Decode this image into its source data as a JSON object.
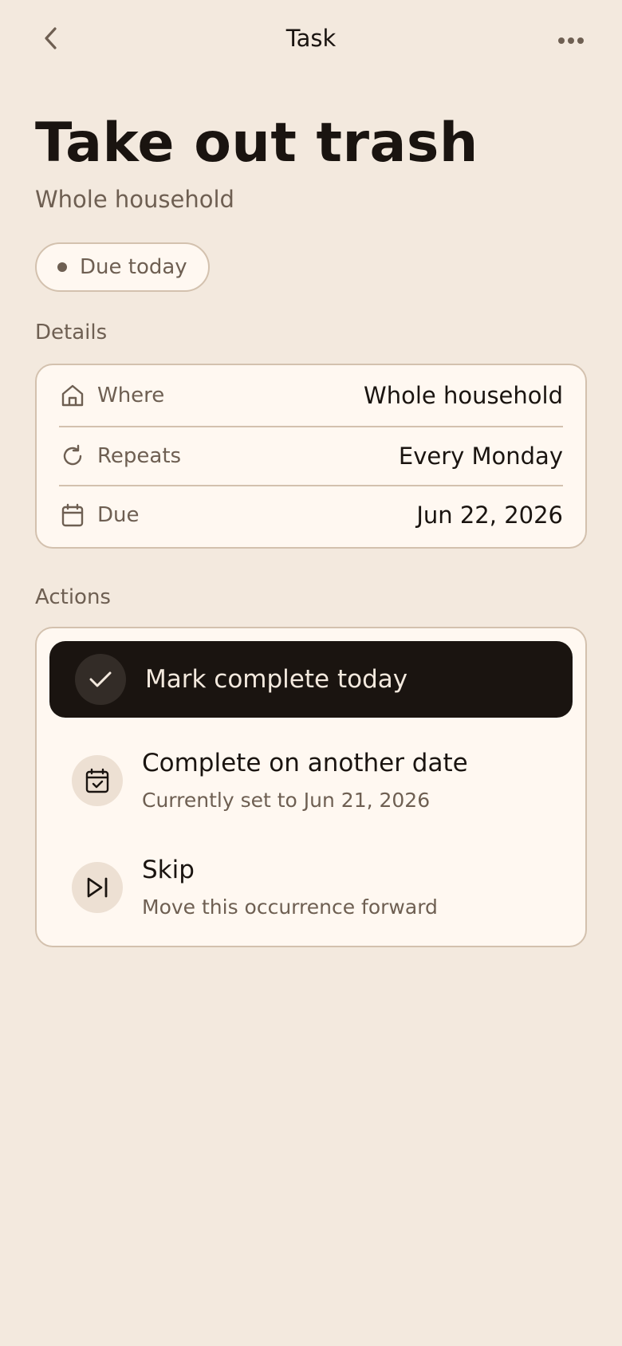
{
  "header": {
    "title": "Task",
    "back_icon": "chevron-left-icon",
    "more_icon": "more-horizontal-icon"
  },
  "task": {
    "title": "Take out trash",
    "subtitle": "Whole household",
    "status": "Due today"
  },
  "details": {
    "label": "Details",
    "rows": [
      {
        "label": "Where",
        "value": "Whole household",
        "icon": "home-icon"
      },
      {
        "label": "Repeats",
        "value": "Every Monday",
        "icon": "repeat-icon"
      },
      {
        "label": "Due",
        "value": "Jun 22, 2026",
        "icon": "calendar-icon"
      }
    ]
  },
  "actions": {
    "label": "Actions",
    "primary": {
      "label": "Mark complete today",
      "icon": "check-icon"
    },
    "items": [
      {
        "title": "Complete on another date",
        "subtitle": "Currently set to Jun 21, 2026",
        "icon": "calendar-check-icon"
      },
      {
        "title": "Skip",
        "subtitle": "Move this occurrence forward",
        "icon": "skip-forward-icon"
      }
    ]
  },
  "colors": {
    "background": "#f3e9de",
    "card": "#fff8f1",
    "border": "#d3c1ae",
    "text_primary": "#1a1410",
    "text_secondary": "#6e5f52",
    "primary_button": "#1a1410"
  }
}
